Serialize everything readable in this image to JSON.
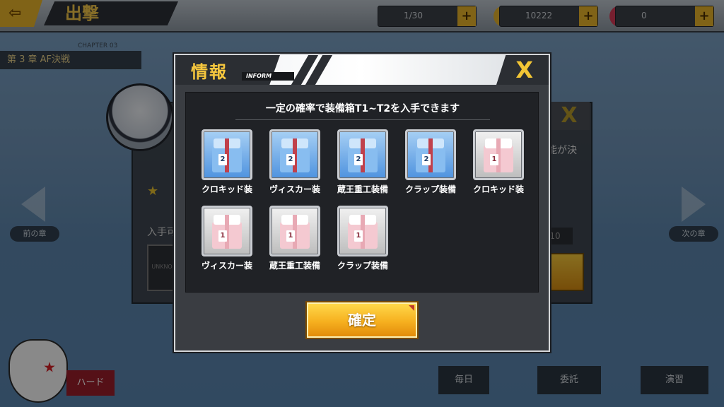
{
  "background": {
    "top_title": "出撃",
    "resource_values": [
      "1/30",
      "10222",
      "0"
    ],
    "chapter": "第 3 章   AF決戦",
    "chapter_label": "CHAPTER 03",
    "right_text": "能が決",
    "left_label": "入手可",
    "slot_text": "UNKNOWN",
    "field_value": "10",
    "prev_label": "前の章",
    "next_label": "次の章",
    "hard_label": "ハード",
    "bottom_cards": [
      "毎日",
      "委託",
      "演習"
    ]
  },
  "dialog": {
    "title": "情報",
    "subtitle": "INFORM",
    "close_label": "X",
    "heading": "一定の確率で装備箱T1~T2を入手できます",
    "items": [
      {
        "label": "クロキッド装",
        "tier": "2",
        "icon": "equipment-box-t2-icon"
      },
      {
        "label": "ヴィスカー装",
        "tier": "2",
        "icon": "equipment-box-t2-icon"
      },
      {
        "label": "蔵王重工装備",
        "tier": "2",
        "icon": "equipment-box-t2-icon"
      },
      {
        "label": "クラップ装備",
        "tier": "2",
        "icon": "equipment-box-t2-icon"
      },
      {
        "label": "クロキッド装",
        "tier": "1",
        "icon": "equipment-box-t1-icon"
      },
      {
        "label": "ヴィスカー装",
        "tier": "1",
        "icon": "equipment-box-t1-icon"
      },
      {
        "label": "蔵王重工装備",
        "tier": "1",
        "icon": "equipment-box-t1-icon"
      },
      {
        "label": "クラップ装備",
        "tier": "1",
        "icon": "equipment-box-t1-icon"
      }
    ],
    "confirm_label": "確定"
  },
  "colors": {
    "accent_gold": "#f6c73e",
    "tier2_blue": "#4f93df",
    "tier1_pink": "#f4c9d1",
    "confirm_orange": "#f6b01f"
  }
}
